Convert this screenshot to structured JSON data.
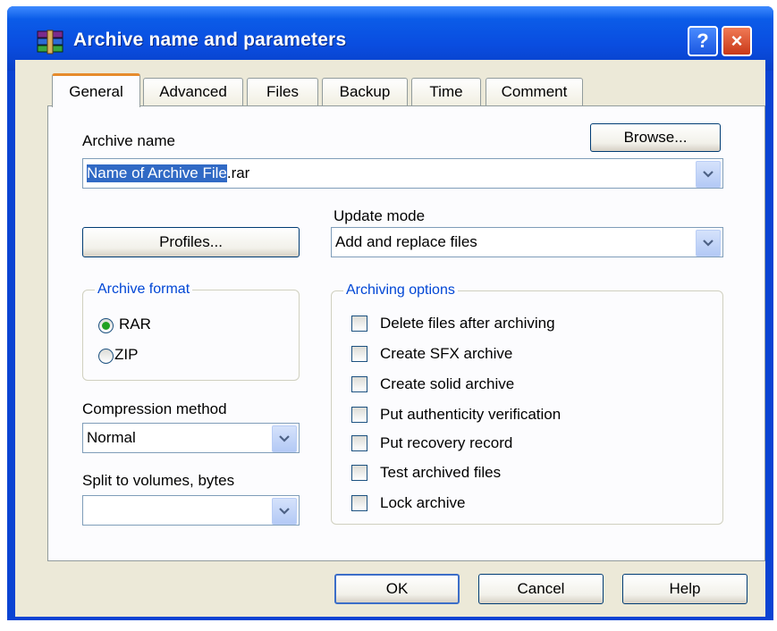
{
  "window": {
    "title": "Archive name and parameters",
    "help_caption": "?",
    "close_caption": "×"
  },
  "tabs": [
    {
      "label": "General",
      "active": true
    },
    {
      "label": "Advanced",
      "active": false
    },
    {
      "label": "Files",
      "active": false
    },
    {
      "label": "Backup",
      "active": false
    },
    {
      "label": "Time",
      "active": false
    },
    {
      "label": "Comment",
      "active": false
    }
  ],
  "archive_name": {
    "label": "Archive name",
    "browse_label": "Browse...",
    "value_selected": "Name of Archive File",
    "value_rest": ".rar"
  },
  "update_mode": {
    "label": "Update mode",
    "value": "Add and replace files"
  },
  "profiles_label": "Profiles...",
  "archive_format": {
    "title": "Archive format",
    "options": [
      {
        "label": "RAR",
        "selected": true
      },
      {
        "label": "ZIP",
        "selected": false
      }
    ]
  },
  "compression": {
    "label": "Compression method",
    "value": "Normal"
  },
  "split": {
    "label": "Split to volumes, bytes",
    "value": ""
  },
  "archiving_options": {
    "title": "Archiving options",
    "items": [
      {
        "label": "Delete files after archiving",
        "checked": false
      },
      {
        "label": "Create SFX archive",
        "checked": false
      },
      {
        "label": "Create solid archive",
        "checked": false
      },
      {
        "label": "Put authenticity verification",
        "checked": false
      },
      {
        "label": "Put recovery record",
        "checked": false
      },
      {
        "label": "Test archived files",
        "checked": false
      },
      {
        "label": "Lock archive",
        "checked": false
      }
    ]
  },
  "buttons": {
    "ok": "OK",
    "cancel": "Cancel",
    "help": "Help"
  },
  "colors": {
    "title_bar": "#0a4de0",
    "dialog_face": "#ece9d8",
    "group_title": "#0046d5",
    "selection": "#316ac5",
    "active_tab_accent": "#e68b2c"
  }
}
